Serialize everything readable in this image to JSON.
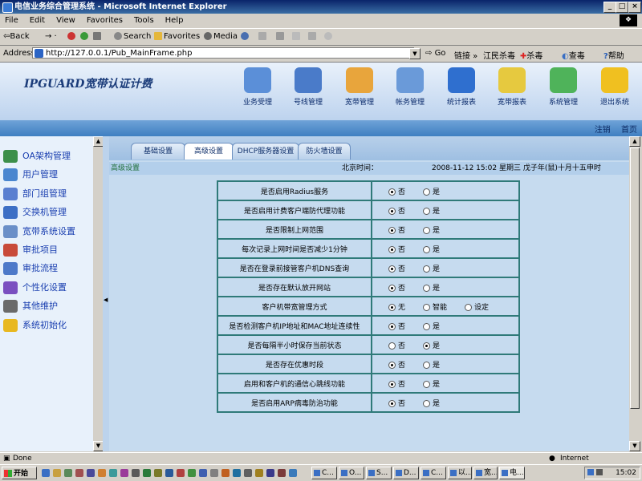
{
  "window": {
    "title": "电信业务综合管理系统 - Microsoft Internet Explorer"
  },
  "menu": [
    "File",
    "Edit",
    "View",
    "Favorites",
    "Tools",
    "Help"
  ],
  "toolbar": {
    "back": "Back",
    "search": "Search",
    "favorites": "Favorites",
    "media": "Media"
  },
  "address": {
    "label": "Address",
    "url": "http://127.0.0.1/Pub_MainFrame.php",
    "go": "Go",
    "links": "链接",
    "extra1": "江民杀毒",
    "extra2": "杀毒",
    "extra3": "查毒",
    "help": "帮助"
  },
  "brand": "IPGUARD宽带认证计费",
  "nav": [
    {
      "label": "业务受理",
      "color": "#5b8fd8"
    },
    {
      "label": "号线管理",
      "color": "#4a7bc9"
    },
    {
      "label": "宽带管理",
      "color": "#e8a53c"
    },
    {
      "label": "帐务管理",
      "color": "#6a9ad9"
    },
    {
      "label": "统计报表",
      "color": "#2f6fcf"
    },
    {
      "label": "宽带报表",
      "color": "#e6c93f"
    },
    {
      "label": "系统管理",
      "color": "#4fb35a"
    },
    {
      "label": "退出系统",
      "color": "#f0c020"
    }
  ],
  "topright": {
    "logout": "注销",
    "home": "首页"
  },
  "sidebar": [
    {
      "label": "OA架构管理",
      "color": "#3c8f4a"
    },
    {
      "label": "用户管理",
      "color": "#4a86cf"
    },
    {
      "label": "部门组管理",
      "color": "#5a7fd0"
    },
    {
      "label": "交换机管理",
      "color": "#3d6fc5"
    },
    {
      "label": "宽带系统设置",
      "color": "#6a8fc8"
    },
    {
      "label": "审批项目",
      "color": "#c84a3a"
    },
    {
      "label": "审批流程",
      "color": "#4d79c9"
    },
    {
      "label": "个性化设置",
      "color": "#7a4fc0"
    },
    {
      "label": "其他维护",
      "color": "#6a6a6a"
    },
    {
      "label": "系统初始化",
      "color": "#e8b820"
    }
  ],
  "tabs": [
    "基础设置",
    "高级设置",
    "DHCP服务器设置",
    "防火墙设置"
  ],
  "infobar": {
    "section": "高级设置",
    "time_label": "北京时间：",
    "datetime": "2008-11-12 15:02 星期三 戊子年(鼠)十月十五申时"
  },
  "settings": [
    {
      "question": "是否启用Radius服务",
      "options": [
        "否",
        "是"
      ],
      "selected": 0
    },
    {
      "question": "是否启用计费客户端防代理功能",
      "options": [
        "否",
        "是"
      ],
      "selected": 0
    },
    {
      "question": "是否限制上网范围",
      "options": [
        "否",
        "是"
      ],
      "selected": 0
    },
    {
      "question": "每次记录上网时间是否减少1分钟",
      "options": [
        "否",
        "是"
      ],
      "selected": 0
    },
    {
      "question": "是否在登录前接管客户机DNS查询",
      "options": [
        "否",
        "是"
      ],
      "selected": 0
    },
    {
      "question": "是否存在默认放开网站",
      "options": [
        "否",
        "是"
      ],
      "selected": 0
    },
    {
      "question": "客户机带宽管理方式",
      "options": [
        "无",
        "智能",
        "设定"
      ],
      "selected": 0
    },
    {
      "question": "是否检测客户机IP地址和MAC地址连续性",
      "options": [
        "否",
        "是"
      ],
      "selected": 0
    },
    {
      "question": "是否每隔半小时保存当前状态",
      "options": [
        "否",
        "是"
      ],
      "selected": 1
    },
    {
      "question": "是否存在优惠时段",
      "options": [
        "否",
        "是"
      ],
      "selected": 0
    },
    {
      "question": "启用和客户机的通信心跳线功能",
      "options": [
        "否",
        "是"
      ],
      "selected": 0
    },
    {
      "question": "是否启用ARP病毒防治功能",
      "options": [
        "否",
        "是"
      ],
      "selected": 0
    }
  ],
  "status": {
    "text": "Done",
    "zone": "Internet"
  },
  "taskbar": {
    "start": "开始",
    "clock": "15:02",
    "buttons": [
      "C...",
      "O...",
      "S...",
      "D...",
      "C...",
      "以...",
      "宽...",
      "电..."
    ]
  }
}
